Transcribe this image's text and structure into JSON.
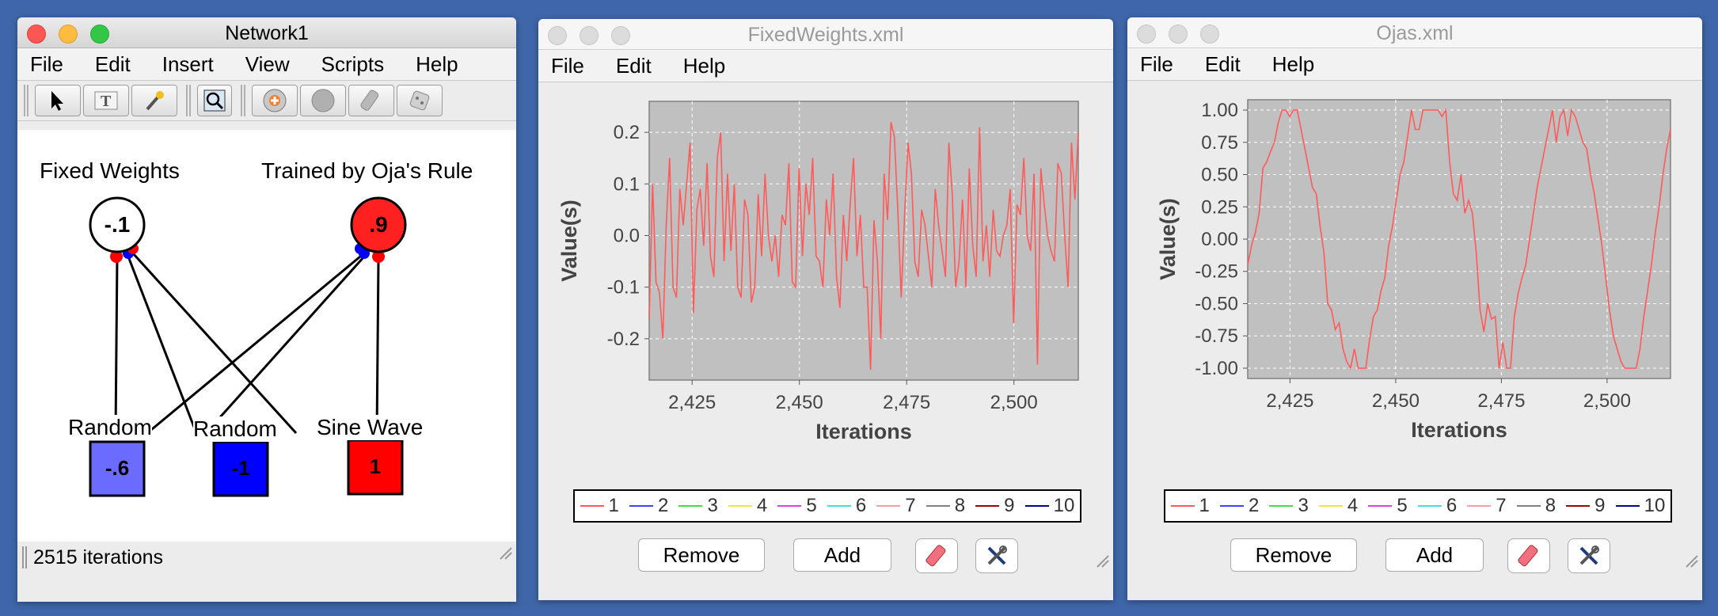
{
  "windows": {
    "network": {
      "title": "Network1",
      "menu": [
        "File",
        "Edit",
        "Insert",
        "View",
        "Scripts",
        "Help"
      ],
      "status": "2515 iterations",
      "labels": {
        "fixed": "Fixed Weights",
        "trained": "Trained by Oja's Rule",
        "random1": "Random",
        "random2": "Random",
        "sine": "Sine Wave"
      },
      "neurons": {
        "fixed_value": "-.1",
        "trained_value": ".9",
        "in1_value": "-.6",
        "in2_value": "-1",
        "in3_value": "1"
      },
      "colors": {
        "fixed_fill": "#ffffff",
        "trained_fill": "#ff2020",
        "in1_fill": "#6b6bff",
        "in2_fill": "#0000ff",
        "in3_fill": "#ff0000"
      }
    },
    "fixed_plot": {
      "title": "FixedWeights.xml",
      "menu": [
        "File",
        "Edit",
        "Help"
      ],
      "remove_label": "Remove",
      "add_label": "Add"
    },
    "oja_plot": {
      "title": "Ojas.xml",
      "menu": [
        "File",
        "Edit",
        "Help"
      ],
      "remove_label": "Remove",
      "add_label": "Add"
    }
  },
  "toolbar_icons": [
    "select-arrow-icon",
    "text-tool-icon",
    "wand-icon",
    "zoom-icon",
    "add-neuron-icon",
    "clear-icon",
    "eraser-icon",
    "random-dice-icon"
  ],
  "legend": [
    {
      "label": "1",
      "color": "#ff5a5a"
    },
    {
      "label": "2",
      "color": "#4040ff"
    },
    {
      "label": "3",
      "color": "#40e040"
    },
    {
      "label": "4",
      "color": "#e8e840"
    },
    {
      "label": "5",
      "color": "#e040e0"
    },
    {
      "label": "6",
      "color": "#40e0e0"
    },
    {
      "label": "7",
      "color": "#ff9aa8"
    },
    {
      "label": "8",
      "color": "#808080"
    },
    {
      "label": "9",
      "color": "#a00000"
    },
    {
      "label": "10",
      "color": "#000090"
    }
  ],
  "chart_data": [
    {
      "type": "line",
      "xlabel": "Iterations",
      "ylabel": "Value(s)",
      "xlim": [
        2415,
        2515
      ],
      "ylim": [
        -0.28,
        0.26
      ],
      "xticks": [
        2425,
        2450,
        2475,
        2500
      ],
      "xtick_labels": [
        "2,425",
        "2,450",
        "2,475",
        "2,500"
      ],
      "yticks": [
        -0.2,
        -0.1,
        0.0,
        0.1,
        0.2
      ],
      "ytick_labels": [
        "-0.2",
        "-0.1",
        "0.0",
        "0.1",
        "0.2"
      ],
      "grid": true,
      "series": [
        {
          "name": "1",
          "color": "#ff5a5a",
          "x0": 2415,
          "values": [
            -0.16,
            0.1,
            -0.09,
            -0.11,
            -0.2,
            0.02,
            0.15,
            -0.1,
            -0.12,
            0.09,
            0.02,
            0.1,
            0.18,
            -0.15,
            0.05,
            0.09,
            -0.02,
            0.14,
            -0.04,
            -0.08,
            0.15,
            0.2,
            -0.05,
            0.12,
            -0.03,
            0.1,
            -0.1,
            -0.12,
            0.07,
            0.04,
            -0.13,
            -0.1,
            0.08,
            -0.04,
            0.12,
            0.0,
            -0.05,
            0.0,
            -0.08,
            0.04,
            0.02,
            0.14,
            -0.09,
            -0.1,
            0.13,
            -0.04,
            0.1,
            0.04,
            0.15,
            -0.04,
            -0.05,
            -0.1,
            0.07,
            0.0,
            0.12,
            -0.08,
            -0.14,
            0.04,
            -0.05,
            0.06,
            0.15,
            -0.04,
            0.04,
            -0.1,
            -0.1,
            -0.26,
            0.03,
            -0.05,
            -0.2,
            0.12,
            0.03,
            0.22,
            0.19,
            0.05,
            -0.12,
            0.04,
            0.18,
            0.12,
            -0.05,
            -0.08,
            0.05,
            0.02,
            -0.04,
            -0.1,
            0.09,
            0.02,
            -0.03,
            -0.08,
            0.18,
            0.08,
            -0.1,
            -0.05,
            0.07,
            -0.1,
            0.13,
            -0.02,
            -0.08,
            0.21,
            -0.05,
            0.02,
            -0.08,
            0.05,
            -0.03,
            -0.04,
            0.0,
            0.02,
            0.09,
            -0.17,
            0.06,
            0.04,
            0.15,
            0.0,
            -0.03,
            0.12,
            -0.25,
            0.13,
            0.06,
            0.0,
            -0.03,
            -0.05,
            0.14,
            0.12,
            0.0,
            -0.1,
            0.18,
            0.07,
            0.2
          ]
        }
      ]
    },
    {
      "type": "line",
      "xlabel": "Iterations",
      "ylabel": "Value(s)",
      "xlim": [
        2415,
        2515
      ],
      "ylim": [
        -1.08,
        1.08
      ],
      "xticks": [
        2425,
        2450,
        2475,
        2500
      ],
      "xtick_labels": [
        "2,425",
        "2,450",
        "2,475",
        "2,500"
      ],
      "yticks": [
        -1.0,
        -0.75,
        -0.5,
        -0.25,
        0.0,
        0.25,
        0.5,
        0.75,
        1.0
      ],
      "ytick_labels": [
        "-1.00",
        "-0.75",
        "-0.50",
        "-0.25",
        "0.00",
        "0.25",
        "0.50",
        "0.75",
        "1.00"
      ],
      "grid": true,
      "series": [
        {
          "name": "1",
          "color": "#ff5a5a",
          "x0": 2415,
          "values": [
            -0.2,
            -0.05,
            0.05,
            0.2,
            0.55,
            0.6,
            0.68,
            0.75,
            0.9,
            1.0,
            1.0,
            0.95,
            1.0,
            1.0,
            0.85,
            0.7,
            0.55,
            0.4,
            0.35,
            0.1,
            -0.1,
            -0.5,
            -0.55,
            -0.7,
            -0.65,
            -0.85,
            -0.95,
            -1.0,
            -0.85,
            -1.0,
            -1.0,
            -1.0,
            -0.78,
            -0.6,
            -0.55,
            -0.4,
            -0.3,
            -0.05,
            0.1,
            0.3,
            0.5,
            0.6,
            0.8,
            1.0,
            0.85,
            0.85,
            1.0,
            1.0,
            1.0,
            1.0,
            1.0,
            0.95,
            1.0,
            0.6,
            0.35,
            0.3,
            0.5,
            0.2,
            0.3,
            0.2,
            -0.1,
            -0.55,
            -0.72,
            -0.5,
            -0.62,
            -0.6,
            -1.0,
            -0.8,
            -1.0,
            -1.0,
            -0.6,
            -0.42,
            -0.3,
            -0.2,
            0.0,
            0.2,
            0.4,
            0.55,
            0.7,
            0.85,
            1.0,
            0.75,
            0.95,
            1.0,
            0.8,
            1.0,
            0.95,
            0.85,
            0.75,
            0.7,
            0.5,
            0.35,
            0.15,
            -0.05,
            -0.3,
            -0.55,
            -0.75,
            -0.85,
            -0.95,
            -1.0,
            -1.0,
            -1.0,
            -1.0,
            -0.85,
            -0.6,
            -0.4,
            -0.2,
            0.05,
            0.25,
            0.5,
            0.7,
            0.85
          ]
        }
      ]
    }
  ]
}
